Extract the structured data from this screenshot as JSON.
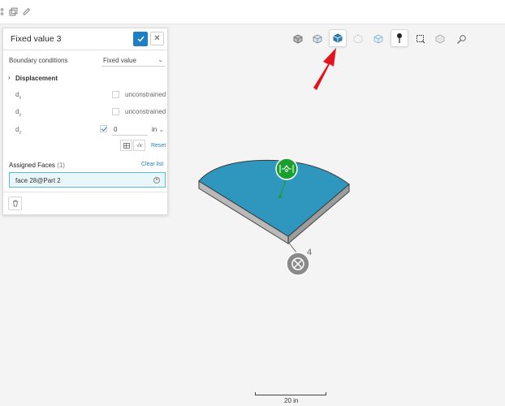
{
  "topbar": {
    "icons": [
      "share-icon",
      "copy-icon",
      "edit-icon"
    ]
  },
  "view_toolbar": {
    "icons": [
      "cube-shaded-icon",
      "cube-wireframe-icon",
      "cube-selected-icon",
      "cube-points-icon",
      "cube-transparent-icon",
      "pin-icon",
      "box-select-icon",
      "cube-hidden-icon",
      "magnifier-icon"
    ],
    "active": "cube-selected-icon"
  },
  "panel": {
    "title": "Fixed value 3",
    "boundary_label": "Boundary conditions",
    "boundary_value": "Fixed value",
    "displacement_label": "Displacement",
    "rows": [
      {
        "label": "d",
        "sub": "x",
        "value": "unconstrained",
        "checked": false
      },
      {
        "label": "d",
        "sub": "y",
        "value": "unconstrained",
        "checked": false
      },
      {
        "label": "d",
        "sub": "z",
        "value": "0",
        "unit": "in",
        "checked": true
      }
    ],
    "reset_label": "Reset",
    "formula_label": "√x",
    "assigned_label": "Assigned Faces",
    "assigned_count": "(1)",
    "clear_label": "Clear list",
    "face_item": "face 28@Part 2"
  },
  "viewport": {
    "node_count": "4",
    "scale_label": "20 in",
    "colors": {
      "face": "#2f97bd",
      "edge": "#555555",
      "marker": "#1a9f2e",
      "arrow": "#e3141d"
    }
  }
}
